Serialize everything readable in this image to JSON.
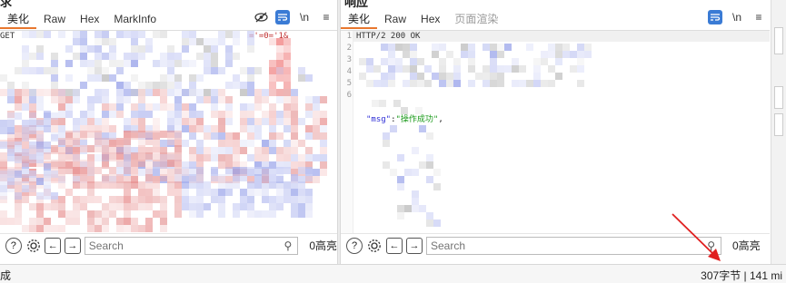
{
  "request": {
    "title": "求",
    "tabs": [
      {
        "label": "美化",
        "active": true
      },
      {
        "label": "Raw"
      },
      {
        "label": "Hex"
      },
      {
        "label": "MarkInfo"
      }
    ],
    "first_line_prefix": "GET",
    "first_line_fragment": "='=0='1&",
    "search_placeholder": "Search",
    "highlight_count": "0高亮",
    "tool_newline": "\\n",
    "tool_menu": "≡"
  },
  "response": {
    "title": "响应",
    "tabs": [
      {
        "label": "美化",
        "active": true
      },
      {
        "label": "Raw"
      },
      {
        "label": "Hex"
      },
      {
        "label": "页面渲染",
        "disabled": true
      }
    ],
    "line_numbers": [
      "1",
      "2",
      "3",
      "4",
      "5",
      "6"
    ],
    "status_line": "HTTP/2 200 OK",
    "json_key": "\"msg\"",
    "json_colon": ":",
    "json_value": "\"操作成功\"",
    "json_comma": ",",
    "search_placeholder": "Search",
    "highlight_count": "0高亮",
    "tool_newline": "\\n",
    "tool_menu": "≡"
  },
  "statusbar": {
    "left_text": "成",
    "right_text": "307字节 | 141 mi"
  },
  "colors": {
    "accent_orange": "#e8772e",
    "toggle_blue": "#3a7bd5",
    "json_key": "#2d2dd6",
    "json_string": "#1a9a1a",
    "arrow_red": "#e02020"
  }
}
